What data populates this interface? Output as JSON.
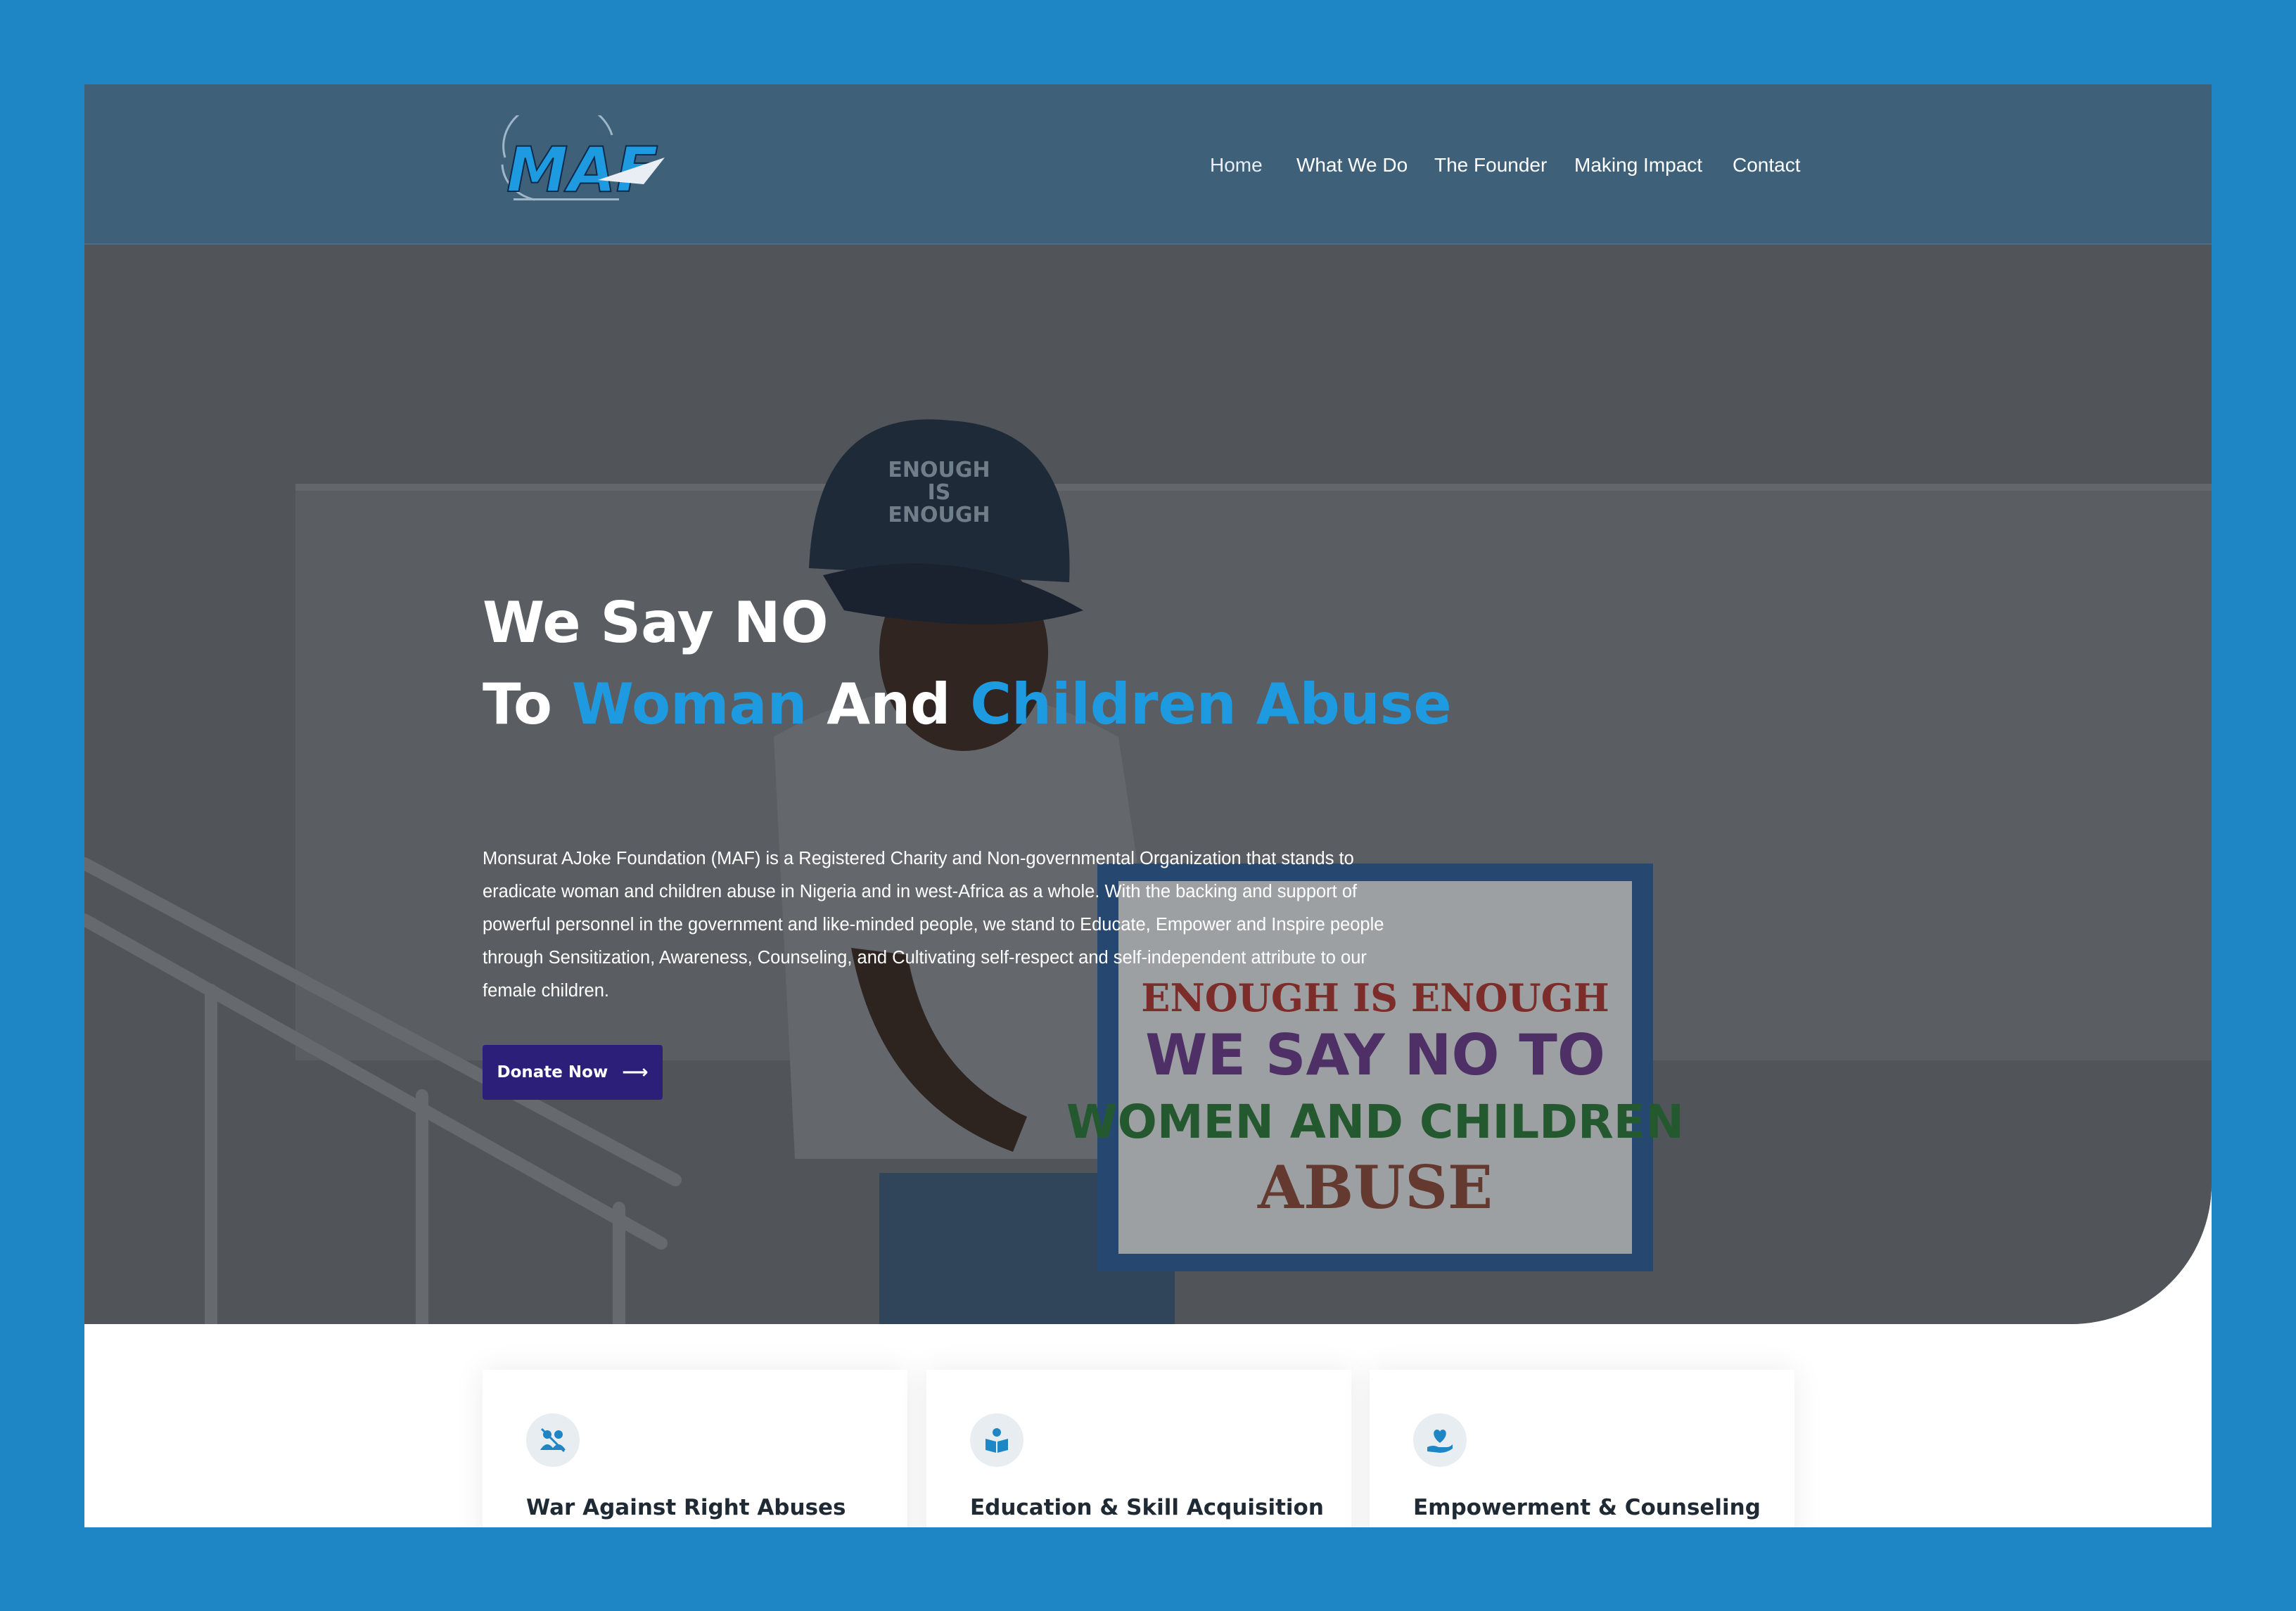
{
  "logo": {
    "text": "MAF"
  },
  "nav": {
    "items": [
      "Home",
      "What We Do",
      "The Founder",
      "Making Impact",
      "Contact"
    ]
  },
  "hero": {
    "line1": "We Say NO",
    "line2_part1": "To",
    "line2_accent1": "Woman",
    "line2_part2": "And",
    "line2_accent2": "Children Abuse",
    "description": "Monsurat AJoke Foundation (MAF) is a Registered Charity and Non-governmental Organization that stands to eradicate woman and children abuse in Nigeria and in west-Africa as a whole. With the backing and support of powerful personnel in the government and like-minded people, we stand to Educate, Empower and Inspire people through Sensitization, Awareness, Counseling, and Cultivating self-respect and self-independent attribute to our female children.",
    "donate_label": "Donate Now",
    "donate_icon": "arrow-right-icon",
    "photo": {
      "cap_text": [
        "ENOUGH",
        "IS",
        "ENOUGH"
      ],
      "placard": {
        "line1": "ENOUGH IS ENOUGH",
        "line2": "WE SAY NO TO",
        "line3": "WOMEN AND CHILDREN",
        "line4": "ABUSE"
      }
    }
  },
  "cards": [
    {
      "title": "War Against Right Abuses",
      "icon": "people-no-abuse-icon"
    },
    {
      "title": "Education & Skill Acquisition",
      "icon": "book-reader-icon"
    },
    {
      "title": "Empowerment & Counseling",
      "icon": "hand-heart-icon"
    }
  ],
  "colors": {
    "background": "#1e86c4",
    "header": "#3f6079",
    "accent": "#1e9be0",
    "button": "#2b1f7a"
  }
}
